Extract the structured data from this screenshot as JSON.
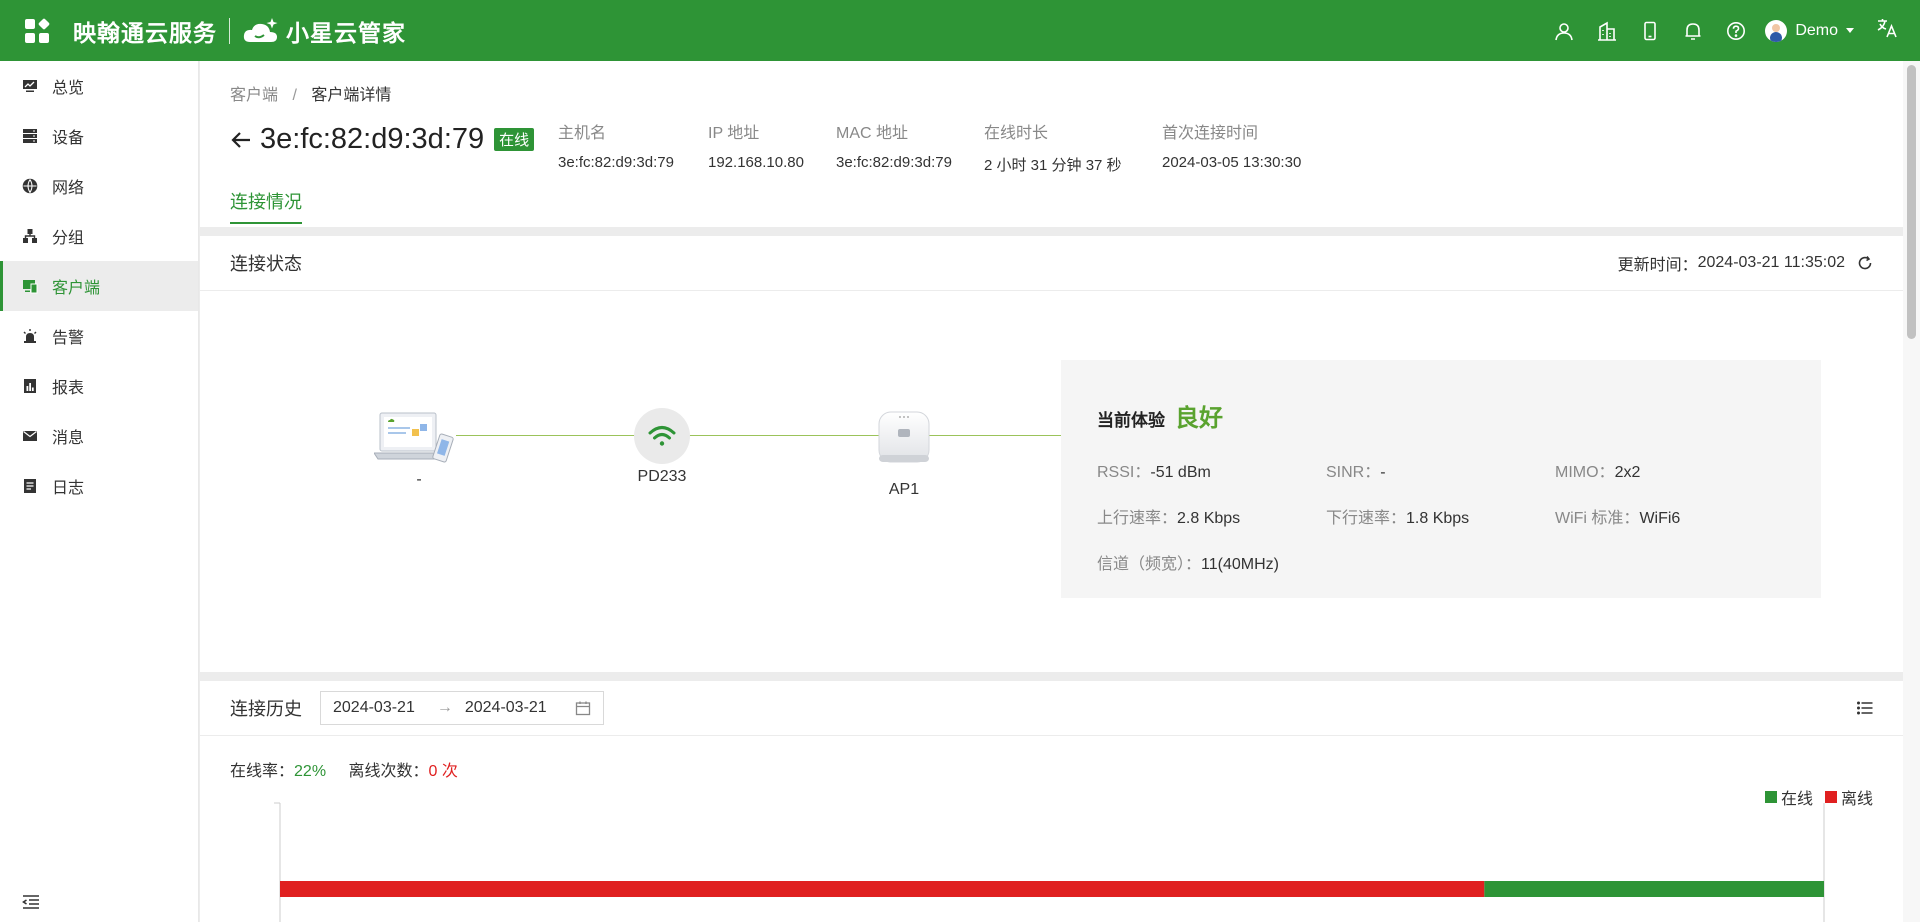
{
  "topbar": {
    "brand": "映翰通云服务",
    "product": "小星云管家",
    "username": "Demo",
    "lang_label": "文A",
    "icons": [
      "user-icon",
      "building-icon",
      "phone-icon",
      "bell-icon",
      "help-icon"
    ]
  },
  "sidebar": {
    "items": [
      {
        "label": "总览",
        "icon": "monitor-icon"
      },
      {
        "label": "设备",
        "icon": "server-icon"
      },
      {
        "label": "网络",
        "icon": "globe-icon"
      },
      {
        "label": "分组",
        "icon": "hierarchy-icon"
      },
      {
        "label": "客户端",
        "icon": "client-icon",
        "active": true
      },
      {
        "label": "告警",
        "icon": "alarm-icon"
      },
      {
        "label": "报表",
        "icon": "report-icon"
      },
      {
        "label": "消息",
        "icon": "mail-icon"
      },
      {
        "label": "日志",
        "icon": "log-icon"
      }
    ]
  },
  "breadcrumb": {
    "parent": "客户端",
    "sep": "/",
    "current": "客户端详情"
  },
  "device": {
    "title": "3e:fc:82:d9:3d:79",
    "status": "在线",
    "meta": [
      {
        "key": "主机名",
        "value": "3e:fc:82:d9:3d:79"
      },
      {
        "key": "IP 地址",
        "value": "192.168.10.80"
      },
      {
        "key": "MAC 地址",
        "value": "3e:fc:82:d9:3d:79"
      },
      {
        "key": "在线时长",
        "value": "2 小时 31 分钟 37 秒"
      },
      {
        "key": "首次连接时间",
        "value": "2024-03-05 13:30:30"
      }
    ]
  },
  "tabs": {
    "active": "连接情况"
  },
  "status_card": {
    "title": "连接状态",
    "update_label": "更新时间：",
    "update_time": "2024-03-21 11:35:02",
    "nodes": {
      "client": "-",
      "ssid": "PD233",
      "ap": "AP1"
    },
    "experience": {
      "label": "当前体验",
      "value": "良好",
      "rssi": {
        "k": "RSSI：",
        "v": "-51 dBm"
      },
      "sinr": {
        "k": "SINR：",
        "v": "-"
      },
      "mimo": {
        "k": "MIMO：",
        "v": "2x2"
      },
      "up": {
        "k": "上行速率：",
        "v": "2.8 Kbps"
      },
      "down": {
        "k": "下行速率：",
        "v": "1.8 Kbps"
      },
      "wifi": {
        "k": "WiFi 标准：",
        "v": "WiFi6"
      },
      "channel": {
        "k": "信道（频宽）：",
        "v": "11(40MHz)"
      }
    }
  },
  "history": {
    "title": "连接历史",
    "start_date": "2024-03-21",
    "arrow": "→",
    "end_date": "2024-03-21",
    "online_rate_label": "在线率：",
    "online_rate": "22%",
    "offline_count_label": "离线次数：",
    "offline_count": "0 次",
    "legend": [
      {
        "name": "在线",
        "color": "#2e9436"
      },
      {
        "name": "离线",
        "color": "#e02020"
      }
    ],
    "timeline": {
      "offline_fraction": 0.78,
      "online_fraction": 0.22
    }
  },
  "colors": {
    "brand": "#2e9436",
    "online": "#2e9436",
    "offline": "#e02020",
    "good": "#5aa32f"
  }
}
